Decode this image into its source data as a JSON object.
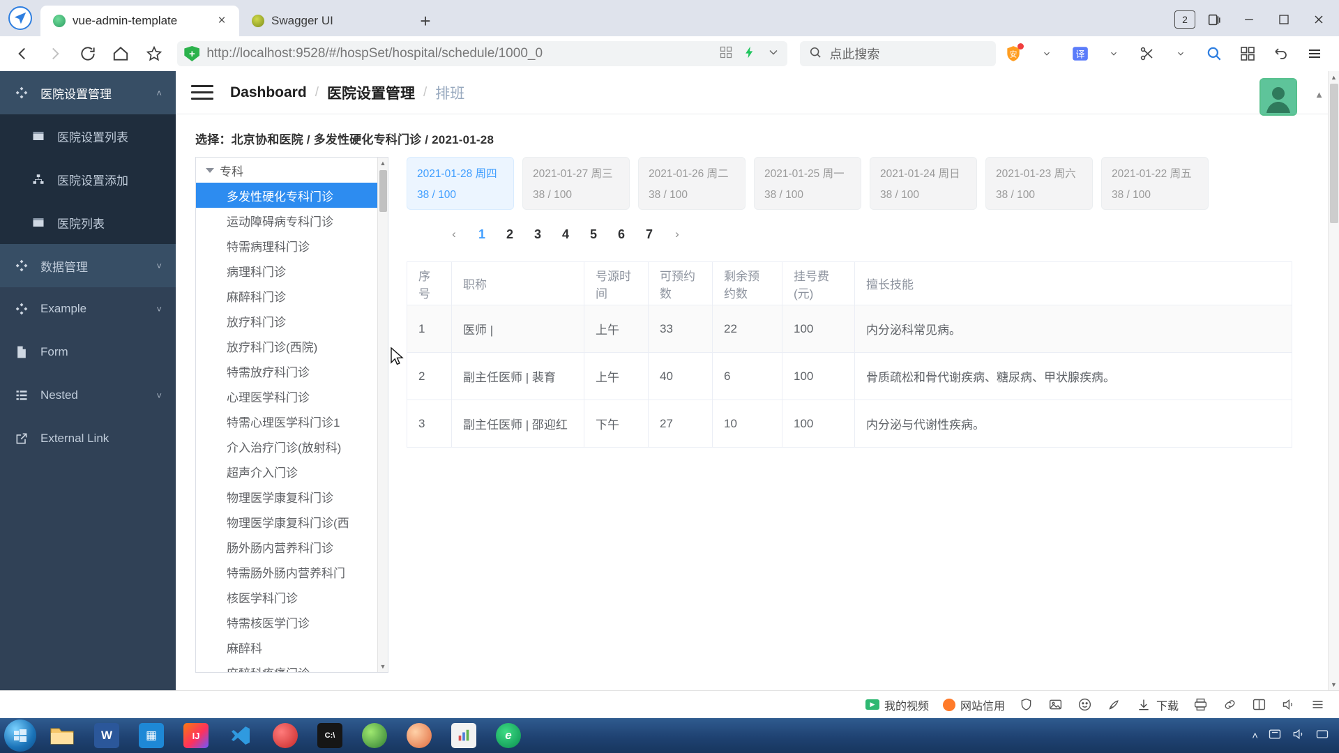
{
  "browser": {
    "tabs": [
      {
        "title": "vue-admin-template",
        "favicon": "vue-favicon",
        "active": true
      },
      {
        "title": "Swagger UI",
        "favicon": "swagger-favicon",
        "active": false
      }
    ],
    "new_tab_label": "+",
    "tab_close_label": "×",
    "tab_counter": "2",
    "window_minimize": "—",
    "window_maximize": "❐",
    "window_close": "✕",
    "url": {
      "scheme": "http://",
      "host": "localhost",
      "rest": ":9528/#/hospSet/hospital/schedule/1000_0",
      "full": "http://localhost:9528/#/hospSet/hospital/schedule/1000_0"
    },
    "search_placeholder": "点此搜索",
    "translate_label": "译",
    "menu_label": "☰"
  },
  "sidebar": {
    "groups": [
      {
        "label": "医院设置管理",
        "icon": "component-icon",
        "expanded": true,
        "caret": "˄"
      },
      {
        "label": "数据管理",
        "icon": "component-icon",
        "expanded": false,
        "caret": "˅"
      },
      {
        "label": "Example",
        "icon": "component-icon",
        "expanded": false,
        "caret": "˅"
      },
      {
        "label": "Form",
        "icon": "form-icon",
        "expanded": false,
        "caret": ""
      },
      {
        "label": "Nested",
        "icon": "nested-icon",
        "expanded": false,
        "caret": "˅"
      },
      {
        "label": "External Link",
        "icon": "external-link-icon",
        "expanded": false,
        "caret": ""
      }
    ],
    "sub_items": [
      {
        "label": "医院设置列表",
        "icon": "table-icon"
      },
      {
        "label": "医院设置添加",
        "icon": "tree-icon"
      },
      {
        "label": "医院列表",
        "icon": "table-icon"
      }
    ]
  },
  "navbar": {
    "breadcrumb": [
      {
        "label": "Dashboard",
        "current": false
      },
      {
        "label": "医院设置管理",
        "current": false
      },
      {
        "label": "排班",
        "current": true
      }
    ],
    "separator": "/"
  },
  "content": {
    "selection_line": "选择：北京协和医院 / 多发性硬化专科门诊 / 2021-01-28",
    "tree": {
      "root_label": "专科",
      "nodes": [
        {
          "label": "多发性硬化专科门诊",
          "selected": true
        },
        {
          "label": "运动障碍病专科门诊",
          "selected": false
        },
        {
          "label": "特需病理科门诊",
          "selected": false
        },
        {
          "label": "病理科门诊",
          "selected": false
        },
        {
          "label": "麻醉科门诊",
          "selected": false
        },
        {
          "label": "放疗科门诊",
          "selected": false
        },
        {
          "label": "放疗科门诊(西院)",
          "selected": false
        },
        {
          "label": "特需放疗科门诊",
          "selected": false
        },
        {
          "label": "心理医学科门诊",
          "selected": false
        },
        {
          "label": "特需心理医学科门诊1",
          "selected": false
        },
        {
          "label": "介入治疗门诊(放射科)",
          "selected": false
        },
        {
          "label": "超声介入门诊",
          "selected": false
        },
        {
          "label": "物理医学康复科门诊",
          "selected": false
        },
        {
          "label": "物理医学康复科门诊(西",
          "selected": false
        },
        {
          "label": "肠外肠内营养科门诊",
          "selected": false
        },
        {
          "label": "特需肠外肠内营养科门",
          "selected": false
        },
        {
          "label": "核医学科门诊",
          "selected": false
        },
        {
          "label": "特需核医学门诊",
          "selected": false
        },
        {
          "label": "麻醉科",
          "selected": false
        },
        {
          "label": "麻醉科疼痛门诊",
          "selected": false
        }
      ]
    },
    "date_cards": [
      {
        "date": "2021-01-28",
        "weekday": "周四",
        "count": "38 / 100",
        "active": true
      },
      {
        "date": "2021-01-27",
        "weekday": "周三",
        "count": "38 / 100",
        "active": false
      },
      {
        "date": "2021-01-26",
        "weekday": "周二",
        "count": "38 / 100",
        "active": false
      },
      {
        "date": "2021-01-25",
        "weekday": "周一",
        "count": "38 / 100",
        "active": false
      },
      {
        "date": "2021-01-24",
        "weekday": "周日",
        "count": "38 / 100",
        "active": false
      },
      {
        "date": "2021-01-23",
        "weekday": "周六",
        "count": "38 / 100",
        "active": false
      },
      {
        "date": "2021-01-22",
        "weekday": "周五",
        "count": "38 / 100",
        "active": false
      }
    ],
    "pagination": {
      "prev": "‹",
      "next": "›",
      "pages": [
        "1",
        "2",
        "3",
        "4",
        "5",
        "6",
        "7"
      ],
      "current": "1"
    },
    "table": {
      "headers": [
        "序号",
        "职称",
        "号源时间",
        "可预约数",
        "剩余预约数",
        "挂号费(元)",
        "擅长技能"
      ],
      "rows": [
        {
          "index": "1",
          "title": "医师 |",
          "time": "上午",
          "available": "33",
          "remaining": "22",
          "fee": "100",
          "skill": "内分泌科常见病。"
        },
        {
          "index": "2",
          "title": "副主任医师 | 裴育",
          "time": "上午",
          "available": "40",
          "remaining": "6",
          "fee": "100",
          "skill": "骨质疏松和骨代谢疾病、糖尿病、甲状腺疾病。"
        },
        {
          "index": "3",
          "title": "副主任医师 | 邵迎红",
          "time": "下午",
          "available": "27",
          "remaining": "10",
          "fee": "100",
          "skill": "内分泌与代谢性疾病。"
        }
      ]
    }
  },
  "statusbar": {
    "items": [
      {
        "label": "我的视频",
        "icon": "video-icon"
      },
      {
        "label": "网站信用",
        "icon": "shield-round-icon"
      },
      {
        "label": "",
        "icon": "shield-icon"
      },
      {
        "label": "",
        "icon": "image-icon"
      },
      {
        "label": "",
        "icon": "smile-icon"
      },
      {
        "label": "",
        "icon": "rocket-icon"
      },
      {
        "label": "下载",
        "icon": "download-icon"
      },
      {
        "label": "",
        "icon": "printer-icon"
      },
      {
        "label": "",
        "icon": "link-icon"
      },
      {
        "label": "",
        "icon": "split-icon"
      },
      {
        "label": "",
        "icon": "volume-icon"
      },
      {
        "label": "",
        "icon": "menu-icon"
      }
    ]
  },
  "taskbar": {
    "apps": [
      {
        "name": "start-orb",
        "label": ""
      },
      {
        "name": "explorer",
        "label": ""
      },
      {
        "name": "word",
        "label": "W"
      },
      {
        "name": "app-blue",
        "label": ""
      },
      {
        "name": "intellij",
        "label": "IJ"
      },
      {
        "name": "vscode",
        "label": ""
      },
      {
        "name": "app-red",
        "label": ""
      },
      {
        "name": "terminal",
        "label": "C:\\"
      },
      {
        "name": "app-green",
        "label": ""
      },
      {
        "name": "app-palette",
        "label": ""
      },
      {
        "name": "app-chart",
        "label": ""
      },
      {
        "name": "edge",
        "label": "e"
      }
    ],
    "tray_caret": "˄"
  },
  "colors": {
    "sidebar_bg": "#304156",
    "sidebar_sub_bg": "#1f2d3d",
    "accent_blue": "#409eff",
    "tree_selected": "#2d8cf0",
    "taskbar": "#1f4272"
  }
}
